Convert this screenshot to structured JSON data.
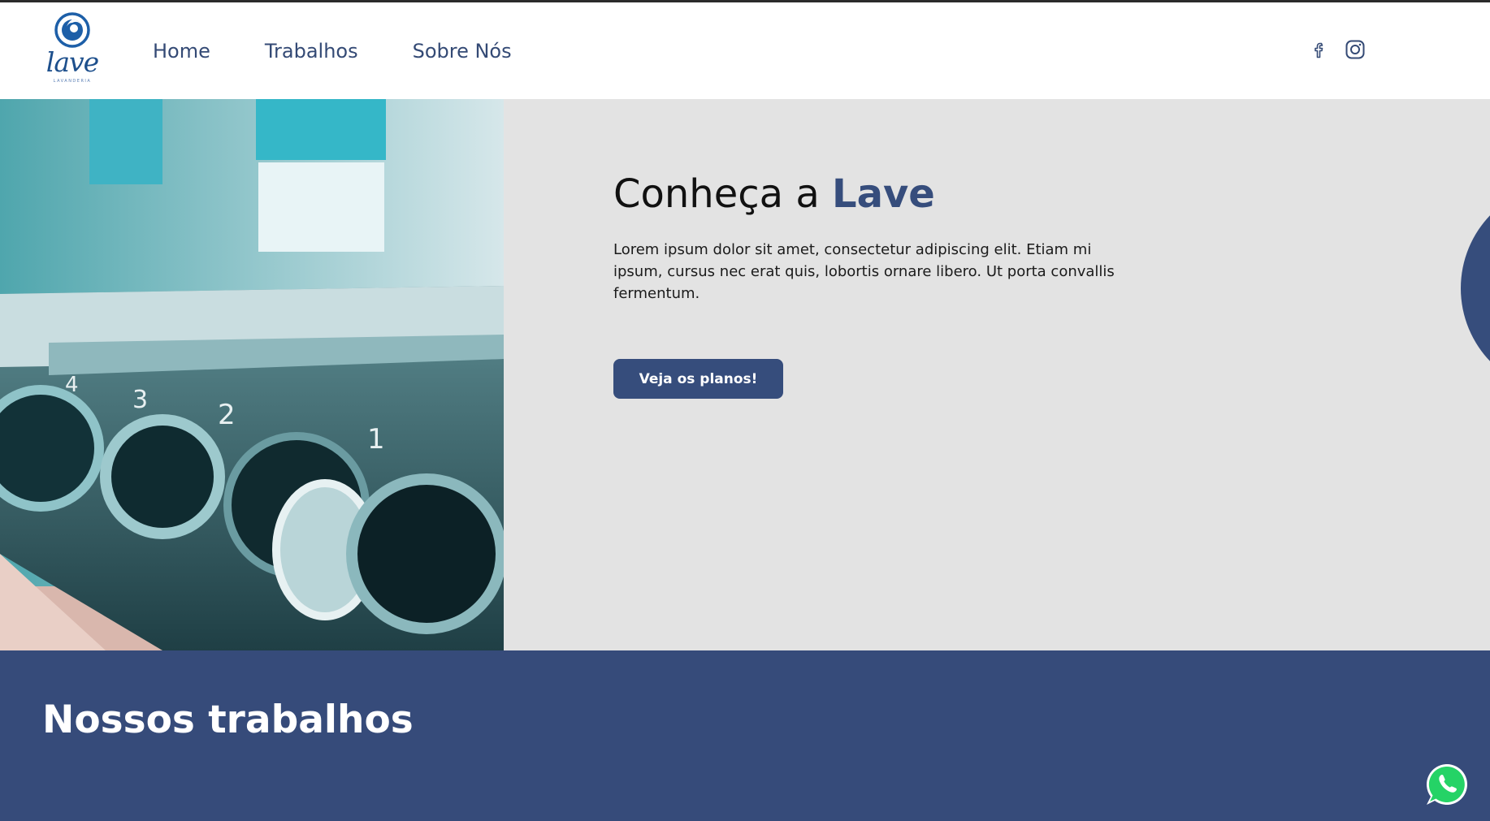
{
  "colors": {
    "brand_blue": "#364d7c",
    "hero_background": "#e3e3e3",
    "works_background": "#364b7a",
    "whatsapp_green": "#25d366"
  },
  "header": {
    "logo": {
      "wordmark": "lave",
      "tagline": "LAVANDERIA",
      "icon": "logo-swirl-icon"
    },
    "nav": [
      {
        "label": "Home"
      },
      {
        "label": "Trabalhos"
      },
      {
        "label": "Sobre Nós"
      }
    ],
    "social": [
      {
        "icon": "facebook-icon"
      },
      {
        "icon": "instagram-icon"
      }
    ]
  },
  "hero": {
    "image_subject": "laundromat washing machines",
    "title_prefix": "Conheça a",
    "title_accent": "Lave",
    "text": "Lorem ipsum dolor sit amet, consectetur adipiscing elit. Etiam mi ipsum, cursus nec erat quis, lobortis ornare libero. Ut porta convallis fermentum.",
    "button_label": "Veja os planos!"
  },
  "works": {
    "title": "Nossos trabalhos"
  },
  "floating": {
    "icon": "whatsapp-icon"
  }
}
